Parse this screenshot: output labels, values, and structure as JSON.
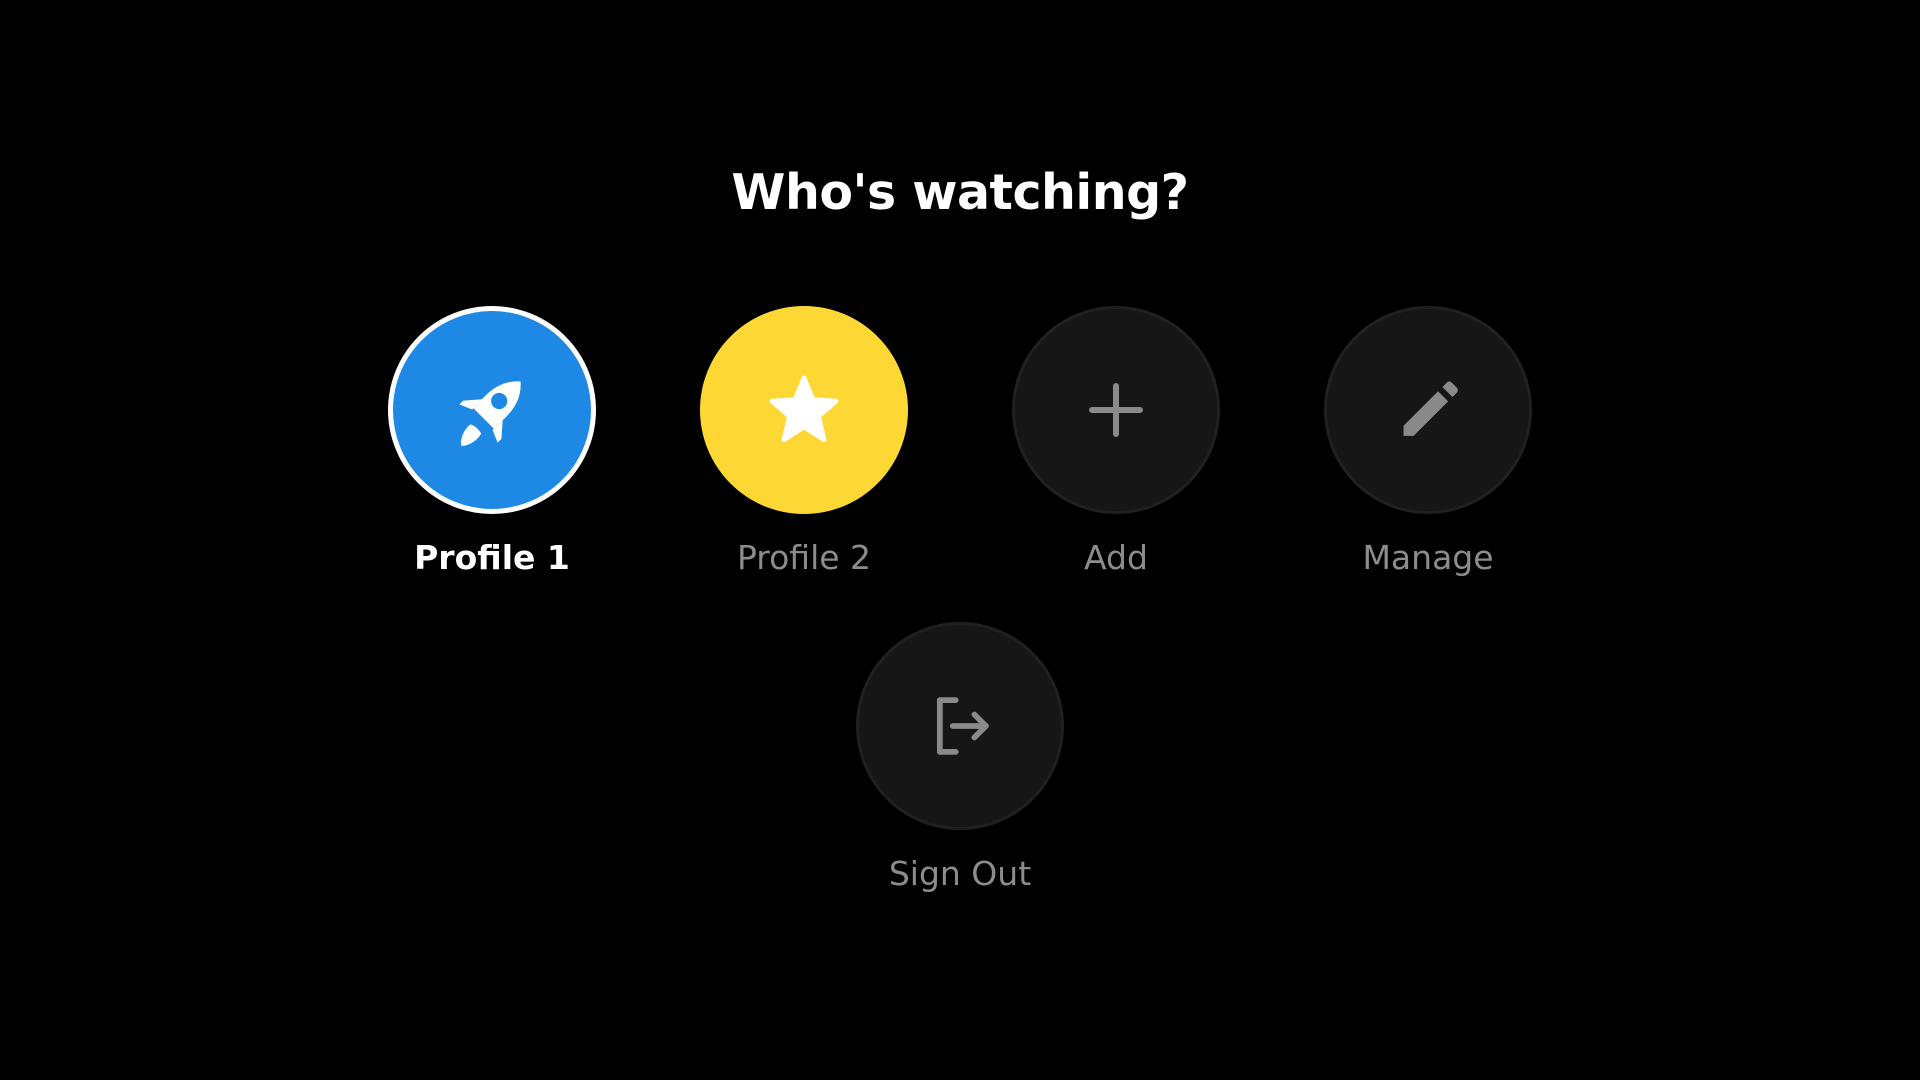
{
  "heading": "Who's watching?",
  "profiles": [
    {
      "label": "Profile 1",
      "icon": "rocket-icon",
      "color": "#1e88e5",
      "selected": true
    },
    {
      "label": "Profile 2",
      "icon": "star-icon",
      "color": "#fdd835",
      "selected": false
    }
  ],
  "actions": {
    "add_label": "Add",
    "add_icon": "plus-icon",
    "manage_label": "Manage",
    "manage_icon": "pencil-icon",
    "signout_label": "Sign Out",
    "signout_icon": "logout-icon"
  },
  "colors": {
    "background": "#000000",
    "selected_text": "#ffffff",
    "inactive_text": "#8c8c8c",
    "action_circle": "#161616",
    "action_icon": "#8a8a8a"
  }
}
